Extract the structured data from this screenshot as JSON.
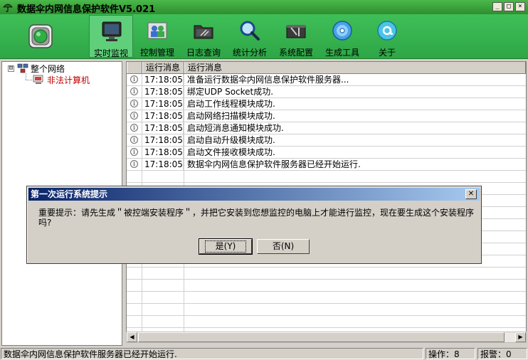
{
  "window": {
    "title": "数据伞内网信息保护软件V5.021",
    "controls": [
      "_",
      "□",
      "×"
    ]
  },
  "toolbar": {
    "items": [
      {
        "label": "实时监视",
        "icon": "monitor-icon",
        "active": true
      },
      {
        "label": "控制管理",
        "icon": "users-icon",
        "active": false
      },
      {
        "label": "日志查询",
        "icon": "folder-icon",
        "active": false
      },
      {
        "label": "统计分析",
        "icon": "magnifier-icon",
        "active": false
      },
      {
        "label": "系统配置",
        "icon": "toolbox-icon",
        "active": false
      },
      {
        "label": "生成工具",
        "icon": "cd-icon",
        "active": false
      },
      {
        "label": "关于",
        "icon": "at-icon",
        "active": false
      }
    ]
  },
  "tree": {
    "root_expander": "⊟",
    "root": "整个网络",
    "child": "非法计算机"
  },
  "log": {
    "headers": [
      "运行消息",
      "运行消息"
    ],
    "rows": [
      {
        "time": "17:18:05",
        "message": "准备运行数据伞内网信息保护软件服务器..."
      },
      {
        "time": "17:18:05",
        "message": "绑定UDP Socket成功."
      },
      {
        "time": "17:18:05",
        "message": "启动工作线程模块成功."
      },
      {
        "time": "17:18:05",
        "message": "启动网络扫描模块成功."
      },
      {
        "time": "17:18:05",
        "message": "启动短消息通知模块成功."
      },
      {
        "time": "17:18:05",
        "message": "启动自动升级模块成功."
      },
      {
        "time": "17:18:05",
        "message": "启动文件接收模块成功."
      },
      {
        "time": "17:18:05",
        "message": "数据伞内网信息保护软件服务器已经开始运行."
      }
    ]
  },
  "dialog": {
    "title": "第一次运行系统提示",
    "message": "重要提示：请先生成＂被控端安装程序＂，并把它安装到您想监控的电脑上才能进行监控，现在要生成这个安装程序吗?",
    "yes_label": "是(Y)",
    "no_label": "否(N)"
  },
  "statusbar": {
    "message": "数据伞内网信息保护软件服务器已经开始运行.",
    "operations": "操作：8",
    "alarms": "报警：0"
  }
}
